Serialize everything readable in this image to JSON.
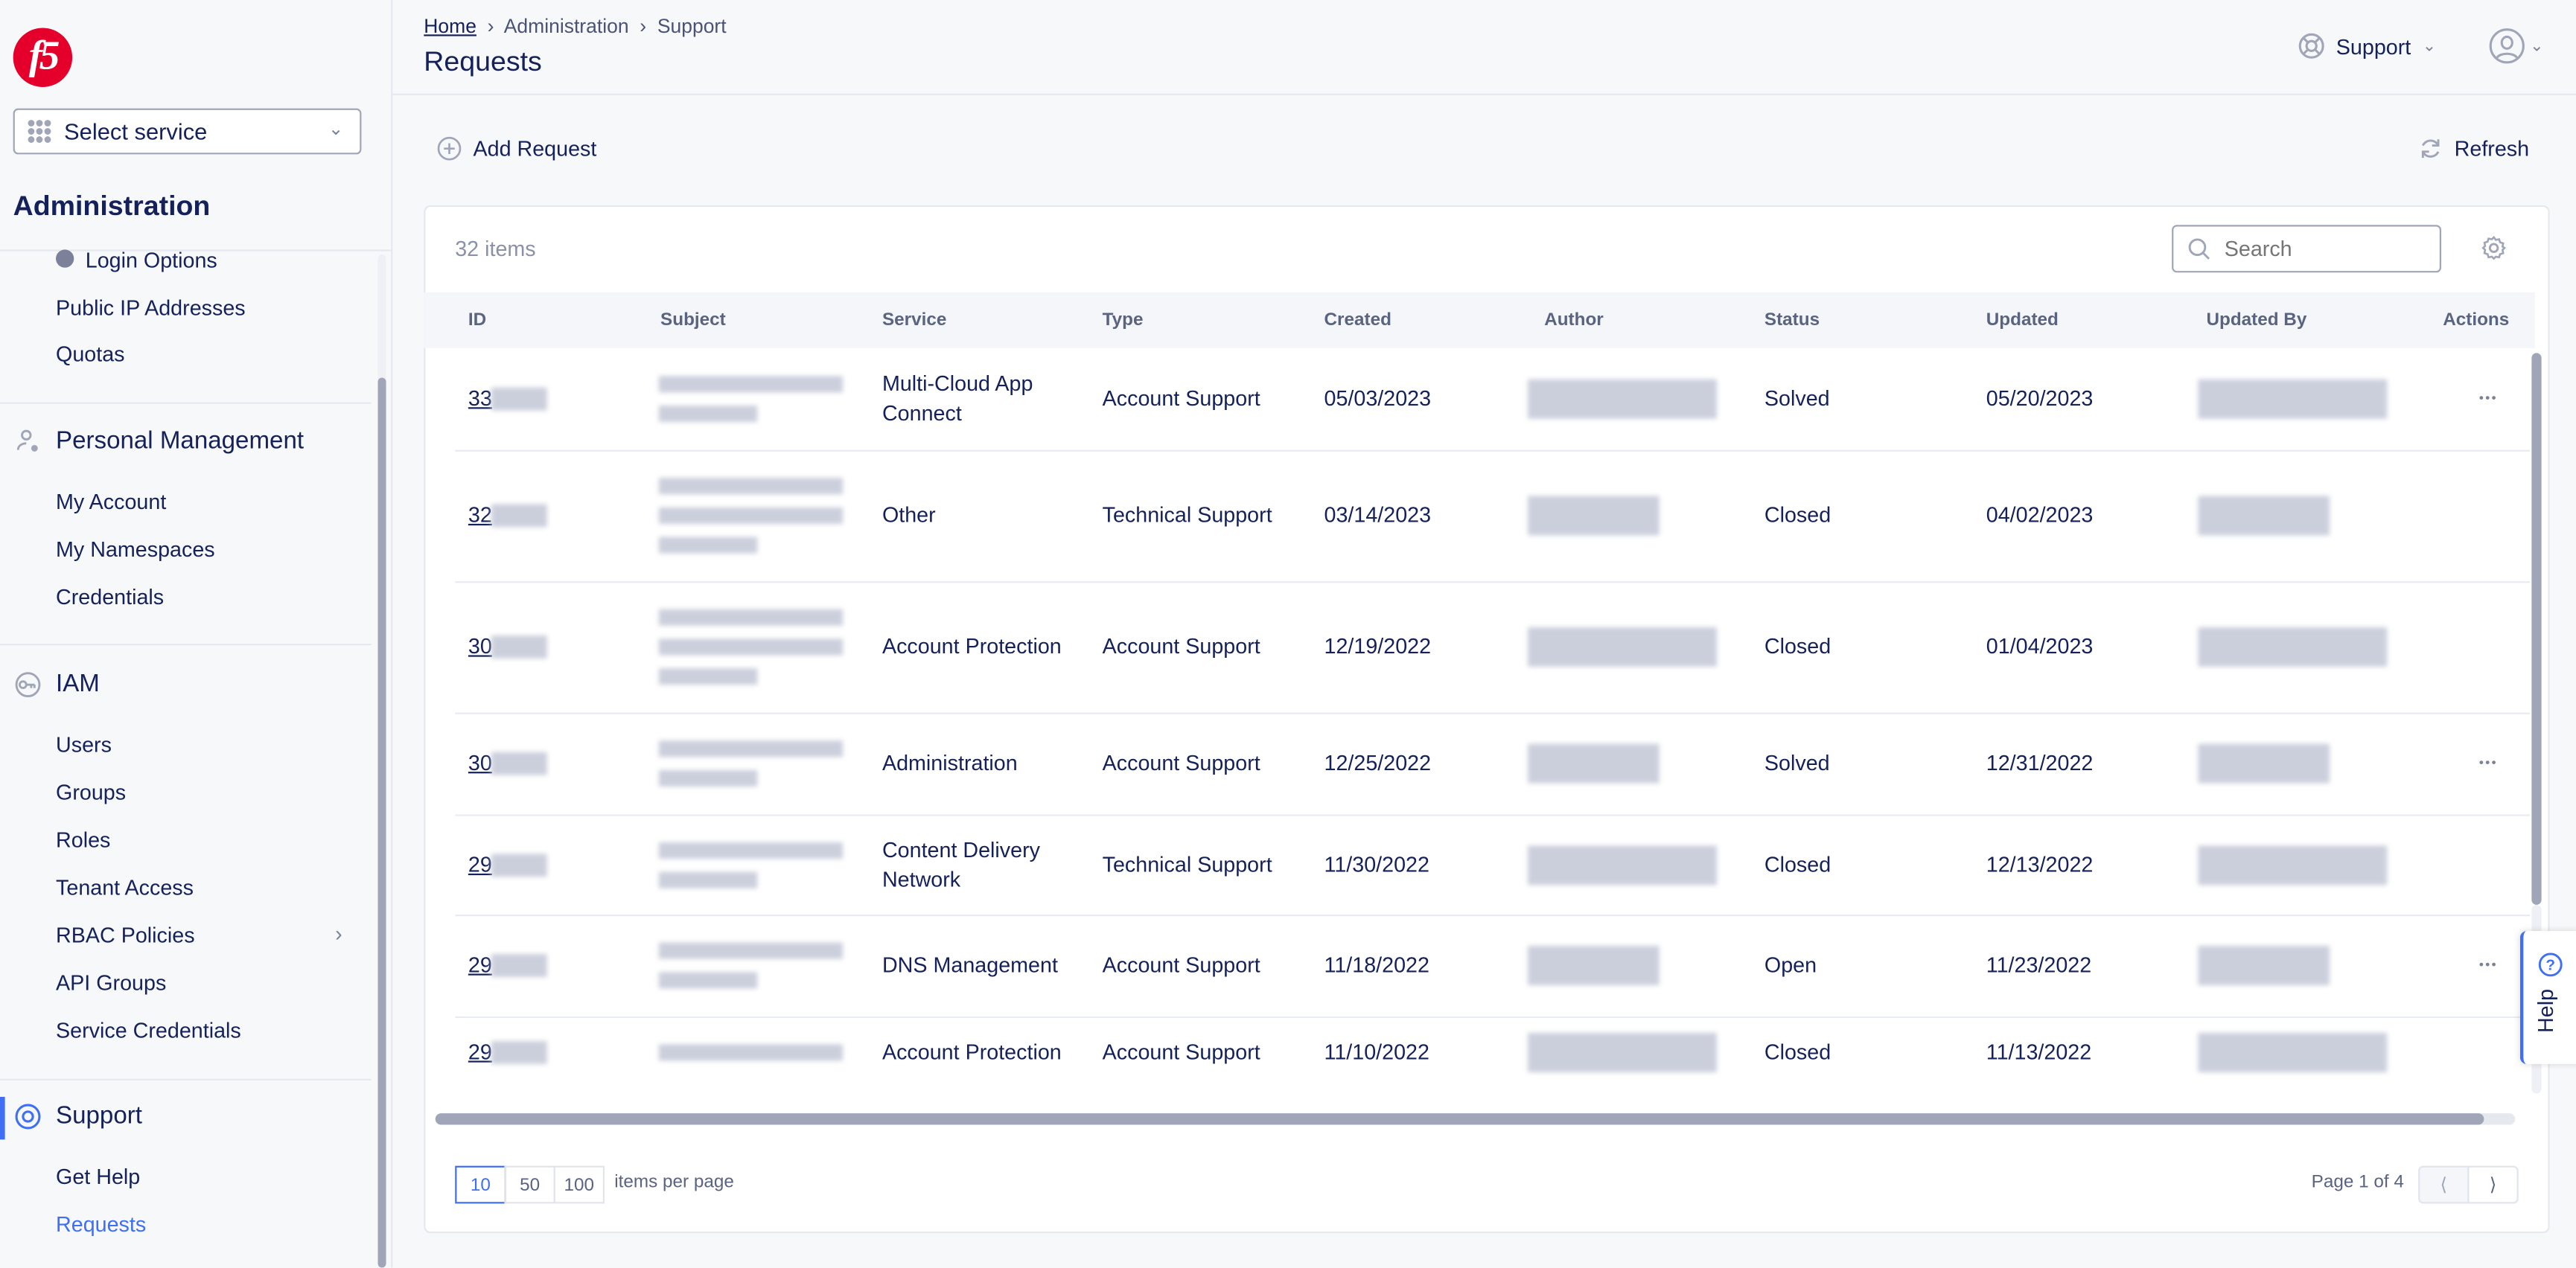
{
  "sidebar": {
    "logo": "f5",
    "select_service": "Select service",
    "section_title": "Administration",
    "admin_items": [
      {
        "label": "Login Options"
      },
      {
        "label": "Public IP Addresses"
      },
      {
        "label": "Quotas"
      }
    ],
    "personal": {
      "label": "Personal Management",
      "icon": "user-gear-icon",
      "items": [
        "My Account",
        "My Namespaces",
        "Credentials"
      ]
    },
    "iam": {
      "label": "IAM",
      "icon": "key-icon",
      "items": [
        "Users",
        "Groups",
        "Roles",
        "Tenant Access",
        "RBAC Policies",
        "API Groups",
        "Service Credentials"
      ]
    },
    "support": {
      "label": "Support",
      "icon": "lifebuoy-icon",
      "items": [
        "Get Help",
        "Requests"
      ],
      "active": "Requests"
    }
  },
  "header": {
    "breadcrumb": [
      "Home",
      "Administration",
      "Support"
    ],
    "title": "Requests",
    "support_menu": "Support"
  },
  "toolbar": {
    "add_label": "Add Request",
    "refresh_label": "Refresh"
  },
  "table": {
    "count": "32 items",
    "search_placeholder": "Search",
    "columns": [
      "ID",
      "Subject",
      "Service",
      "Type",
      "Created",
      "Author",
      "Status",
      "Updated",
      "Updated By",
      "Actions"
    ],
    "rows": [
      {
        "id": "33",
        "service": "Multi-Cloud App Connect",
        "type": "Account Support",
        "created": "05/03/2023",
        "status": "Solved",
        "updated": "05/20/2023",
        "actions": true
      },
      {
        "id": "32",
        "service": "Other",
        "type": "Technical Support",
        "created": "03/14/2023",
        "status": "Closed",
        "updated": "04/02/2023",
        "actions": false
      },
      {
        "id": "30",
        "service": "Account Protection",
        "type": "Account Support",
        "created": "12/19/2022",
        "status": "Closed",
        "updated": "01/04/2023",
        "actions": false
      },
      {
        "id": "30",
        "service": "Administration",
        "type": "Account Support",
        "created": "12/25/2022",
        "status": "Solved",
        "updated": "12/31/2022",
        "actions": true
      },
      {
        "id": "29",
        "service": "Content Delivery Network",
        "type": "Technical Support",
        "created": "11/30/2022",
        "status": "Closed",
        "updated": "12/13/2022",
        "actions": false
      },
      {
        "id": "29",
        "service": "DNS Management",
        "type": "Account Support",
        "created": "11/18/2022",
        "status": "Open",
        "updated": "11/23/2022",
        "actions": true
      },
      {
        "id": "29",
        "service": "Account Protection",
        "type": "Account Support",
        "created": "11/10/2022",
        "status": "Closed",
        "updated": "11/13/2022",
        "actions": false
      }
    ]
  },
  "pagination": {
    "sizes": [
      "10",
      "50",
      "100"
    ],
    "selected": "10",
    "per_page_label": "items per page",
    "page_label": "Page 1 of 4"
  },
  "help": {
    "label": "Help"
  },
  "colors": {
    "accent": "#3e6ff4",
    "text": "#15215a",
    "brand": "#e4002b"
  }
}
